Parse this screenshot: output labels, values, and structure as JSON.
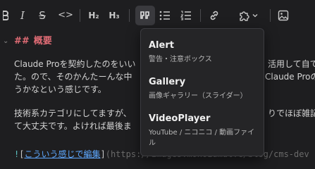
{
  "toolbar": {
    "items": [
      {
        "name": "bold-button",
        "icon": "bold-icon"
      },
      {
        "name": "italic-button",
        "label": "I"
      },
      {
        "name": "strikethrough-button",
        "label": "S"
      },
      {
        "name": "code-button",
        "label": "<>"
      },
      {
        "name": "heading2-button",
        "label": "H₂"
      },
      {
        "name": "heading3-button",
        "label": "H₃"
      },
      {
        "name": "quote-button",
        "icon": "quote-icon"
      },
      {
        "name": "bullet-list-button",
        "icon": "bullet-list-icon"
      },
      {
        "name": "ordered-list-button",
        "icon": "ordered-list-icon"
      },
      {
        "name": "link-button",
        "icon": "link-icon"
      },
      {
        "name": "plugin-button",
        "icon": "puzzle-icon"
      },
      {
        "name": "image-button",
        "icon": "image-icon"
      }
    ]
  },
  "editor": {
    "heading_marker": "##",
    "heading_text": "概要",
    "para1_line1": "Claude Proを契約したのをいい",
    "para1_line1_tail": "活用して自て",
    "para1_line2": "た。ので、そのかんたーんな中",
    "para1_line2_tail": "Claude Proの",
    "para1_line3": "うかなという感じです。",
    "para2_line1": "技術系カテゴリにしてますが、",
    "para2_line1_tail": "りでほぼ雑記",
    "para2_line2": "て大丈夫です。よければ最後ま",
    "link_bang": "!",
    "link_text": "こういう感じで編集",
    "link_url": "(https://images.monoiumut.c/blog/cms-dev"
  },
  "dropdown": {
    "items": [
      {
        "title": "Alert",
        "desc": "警告・注意ボックス"
      },
      {
        "title": "Gallery",
        "desc": "画像ギャラリー（スライダー）"
      },
      {
        "title": "VideoPlayer",
        "desc_line1": "YouTube / ニコニコ / 動画ファイ",
        "desc_line2": "ル"
      }
    ]
  },
  "colors": {
    "background": "#1e1e20",
    "heading": "#e06c75",
    "link": "#5ea8ff",
    "dropdown_bg": "#252527"
  }
}
